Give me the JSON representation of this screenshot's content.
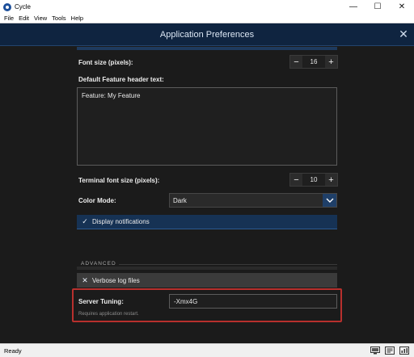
{
  "window": {
    "title": "Cycle",
    "minimize": "—",
    "maximize": "☐",
    "close": "✕"
  },
  "menu": [
    "File",
    "Edit",
    "View",
    "Tools",
    "Help"
  ],
  "dialog": {
    "title": "Application Preferences",
    "close": "✕"
  },
  "font_size": {
    "label": "Font size (pixels):",
    "value": "16",
    "minus": "−",
    "plus": "+"
  },
  "feature_header": {
    "label": "Default Feature header text:",
    "value": "Feature: My Feature"
  },
  "terminal_font_size": {
    "label": "Terminal font size (pixels):",
    "value": "10",
    "minus": "−",
    "plus": "+"
  },
  "color_mode": {
    "label": "Color Mode:",
    "value": "Dark"
  },
  "display_notifications": {
    "label": "Display notifications",
    "checked": true,
    "mark": "✓"
  },
  "advanced": {
    "section_label": "ADVANCED"
  },
  "verbose_log": {
    "label": "Verbose log files",
    "checked": false,
    "mark": "✕"
  },
  "server_tuning": {
    "label": "Server Tuning:",
    "value": "-Xmx4G",
    "hint": "Requires application restart."
  },
  "status": {
    "text": "Ready"
  },
  "colors": {
    "header_bg": "#0f2440",
    "accent": "#1f3f68",
    "highlight_border": "#b8302d",
    "content_bg": "#1b1b1b"
  }
}
